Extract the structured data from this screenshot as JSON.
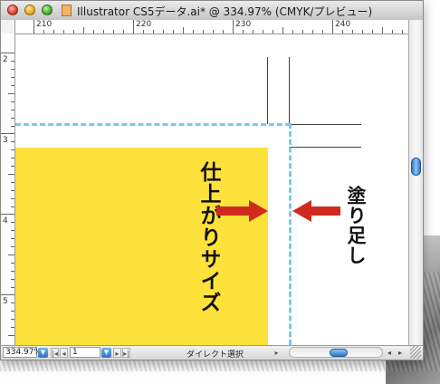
{
  "window": {
    "title": "Illustrator CS5データ.ai* @ 334.97% (CMYK/プレビュー)"
  },
  "colors": {
    "artboard_fill": "#fce23a",
    "bleed_guide": "#7ac8ee",
    "arrow": "#d02a1e"
  },
  "ruler": {
    "horizontal_labels": [
      "210",
      "220",
      "230",
      "240"
    ],
    "vertical_labels": [
      "2",
      "3",
      "4",
      "5"
    ]
  },
  "canvas": {
    "label_finish_size": "仕上がりサイズ",
    "label_bleed": "塗り足し"
  },
  "statusbar": {
    "zoom_value": "334.97%",
    "artboard_number": "1",
    "tool_status": "ダイレクト選択"
  },
  "icons": {
    "close": "close-button",
    "minimize": "minimize-button",
    "zoom": "zoom-button",
    "document": "document-icon",
    "arrow_right": "arrow-right-icon",
    "arrow_left": "arrow-left-icon"
  }
}
